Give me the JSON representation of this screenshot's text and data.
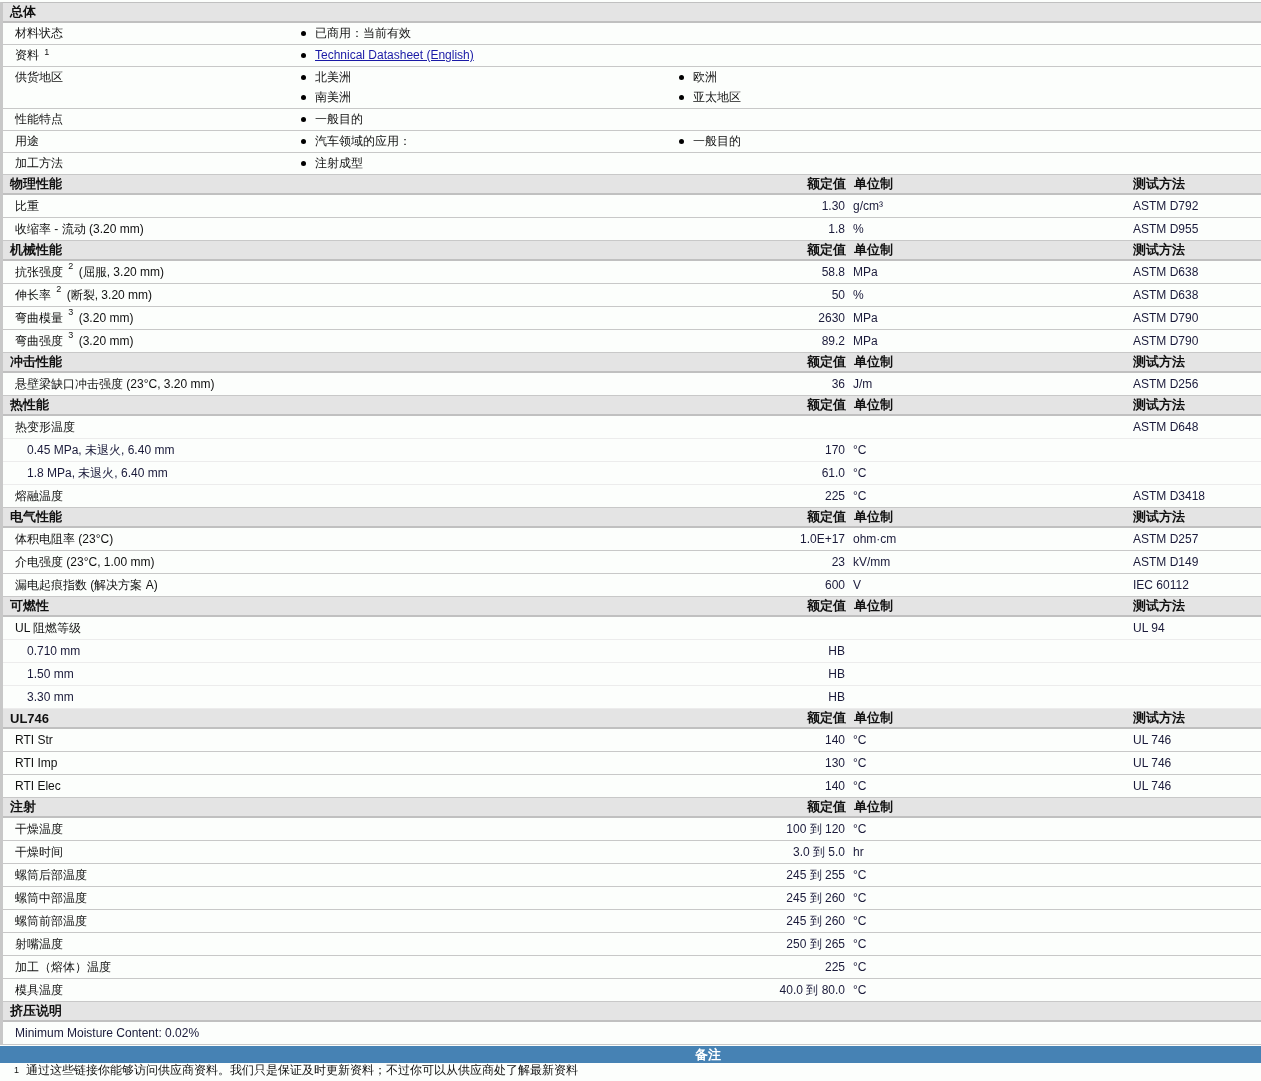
{
  "general": {
    "title": "总体",
    "rows": [
      {
        "label": "材料状态",
        "items": [
          {
            "kind": "text",
            "text": "已商用：当前有效"
          }
        ]
      },
      {
        "label": "资料",
        "note": "1",
        "items": [
          {
            "kind": "link",
            "text": "Technical Datasheet (English)"
          }
        ]
      },
      {
        "label": "供货地区",
        "items": [
          {
            "kind": "text",
            "text": "北美洲"
          },
          {
            "kind": "text",
            "text": "欧洲"
          },
          {
            "kind": "text",
            "text": "南美洲"
          },
          {
            "kind": "text",
            "text": "亚太地区"
          }
        ]
      },
      {
        "label": "性能特点",
        "items": [
          {
            "kind": "text",
            "text": "一般目的"
          }
        ]
      },
      {
        "label": "用途",
        "items": [
          {
            "kind": "text",
            "text": "汽车领域的应用："
          },
          {
            "kind": "text",
            "text": "一般目的"
          }
        ]
      },
      {
        "label": "加工方法",
        "items": [
          {
            "kind": "text",
            "text": "注射成型"
          }
        ]
      }
    ]
  },
  "sections": [
    {
      "title": "物理性能",
      "headers": {
        "value": "额定值",
        "unit": "单位制",
        "method": "测试方法"
      },
      "rows": [
        {
          "kind": "main",
          "label": "比重",
          "value": "1.30",
          "unit": "g/cm³",
          "method": "ASTM D792"
        },
        {
          "kind": "main",
          "label": "收缩率  - 流动  (3.20 mm)",
          "value": "1.8",
          "unit": "%",
          "method": "ASTM D955"
        }
      ]
    },
    {
      "title": "机械性能",
      "headers": {
        "value": "额定值",
        "unit": "单位制",
        "method": "测试方法"
      },
      "rows": [
        {
          "kind": "main",
          "label": "抗张强度",
          "note": "2",
          "condition": "(屈服, 3.20 mm)",
          "value": "58.8",
          "unit": "MPa",
          "method": "ASTM D638"
        },
        {
          "kind": "main",
          "label": "伸长率",
          "note": "2",
          "condition": "(断裂, 3.20 mm)",
          "value": "50",
          "unit": "%",
          "method": "ASTM D638"
        },
        {
          "kind": "main",
          "label": "弯曲模量",
          "note": "3",
          "condition": "(3.20 mm)",
          "value": "2630",
          "unit": "MPa",
          "method": "ASTM D790"
        },
        {
          "kind": "main",
          "label": "弯曲强度",
          "note": "3",
          "condition": "(3.20 mm)",
          "value": "89.2",
          "unit": "MPa",
          "method": "ASTM D790"
        }
      ]
    },
    {
      "title": "冲击性能",
      "headers": {
        "value": "额定值",
        "unit": "单位制",
        "method": "测试方法"
      },
      "rows": [
        {
          "kind": "main",
          "label": "悬壁梁缺口冲击强度  (23°C, 3.20 mm)",
          "value": "36",
          "unit": "J/m",
          "method": "ASTM D256"
        }
      ]
    },
    {
      "title": "热性能",
      "headers": {
        "value": "额定值",
        "unit": "单位制",
        "method": "测试方法"
      },
      "rows": [
        {
          "kind": "parent",
          "label": "热变形温度",
          "method": "ASTM D648"
        },
        {
          "kind": "sub",
          "label": "0.45 MPa, 未退火, 6.40 mm",
          "value": "170",
          "unit": "°C"
        },
        {
          "kind": "sub",
          "label": "1.8 MPa, 未退火, 6.40 mm",
          "value": "61.0",
          "unit": "°C"
        },
        {
          "kind": "main",
          "label": "熔融温度",
          "value": "225",
          "unit": "°C",
          "method": "ASTM D3418"
        }
      ]
    },
    {
      "title": "电气性能",
      "headers": {
        "value": "额定值",
        "unit": "单位制",
        "method": "测试方法"
      },
      "rows": [
        {
          "kind": "main",
          "label": "体积电阻率  (23°C)",
          "value": "1.0E+17",
          "unit": "ohm·cm",
          "method": "ASTM D257"
        },
        {
          "kind": "main",
          "label": "介电强度  (23°C, 1.00 mm)",
          "value": "23",
          "unit": "kV/mm",
          "method": "ASTM D149"
        },
        {
          "kind": "main",
          "label": "漏电起痕指数  (解决方案  A)",
          "value": "600",
          "unit": "V",
          "method": "IEC 60112"
        }
      ]
    },
    {
      "title": "可燃性",
      "headers": {
        "value": "额定值",
        "unit": "单位制",
        "method": "测试方法"
      },
      "rows": [
        {
          "kind": "parent",
          "label": "UL 阻燃等级",
          "method": "UL 94"
        },
        {
          "kind": "sub",
          "label": "0.710 mm",
          "value": "HB"
        },
        {
          "kind": "sub",
          "label": "1.50 mm",
          "value": "HB"
        },
        {
          "kind": "sub",
          "label": "3.30 mm",
          "value": "HB"
        }
      ]
    },
    {
      "title": "UL746",
      "headers": {
        "value": "额定值",
        "unit": "单位制",
        "method": "测试方法"
      },
      "rows": [
        {
          "kind": "main",
          "label": "RTI Str",
          "value": "140",
          "unit": "°C",
          "method": "UL 746"
        },
        {
          "kind": "main",
          "label": "RTI Imp",
          "value": "130",
          "unit": "°C",
          "method": "UL 746"
        },
        {
          "kind": "main",
          "label": "RTI Elec",
          "value": "140",
          "unit": "°C",
          "method": "UL 746"
        }
      ]
    },
    {
      "title": "注射",
      "headers": {
        "value": "额定值",
        "unit": "单位制"
      },
      "rows": [
        {
          "kind": "main",
          "label": "干燥温度",
          "value": "100 到  120",
          "unit": "°C"
        },
        {
          "kind": "main",
          "label": "干燥时间",
          "value": "3.0 到  5.0",
          "unit": "hr"
        },
        {
          "kind": "main",
          "label": "螺筒后部温度",
          "value": "245 到  255",
          "unit": "°C"
        },
        {
          "kind": "main",
          "label": "螺筒中部温度",
          "value": "245 到  260",
          "unit": "°C"
        },
        {
          "kind": "main",
          "label": "螺筒前部温度",
          "value": "245 到  260",
          "unit": "°C"
        },
        {
          "kind": "main",
          "label": "射嘴温度",
          "value": "250 到  265",
          "unit": "°C"
        },
        {
          "kind": "main",
          "label": "加工（熔体）温度",
          "value": "225",
          "unit": "°C"
        },
        {
          "kind": "main",
          "label": "模具温度",
          "value": "40.0 到  80.0",
          "unit": "°C"
        }
      ]
    },
    {
      "title": "挤压说明",
      "rows": [
        {
          "kind": "note",
          "label": "Minimum Moisture Content: 0.02%"
        }
      ]
    }
  ],
  "notes": {
    "title": "备注",
    "footnotes": [
      {
        "number": "1",
        "text": "通过这些链接你能够访问供应商资料。我们只是保证及时更新资料；不过你可以从供应商处了解最新资料"
      }
    ]
  }
}
